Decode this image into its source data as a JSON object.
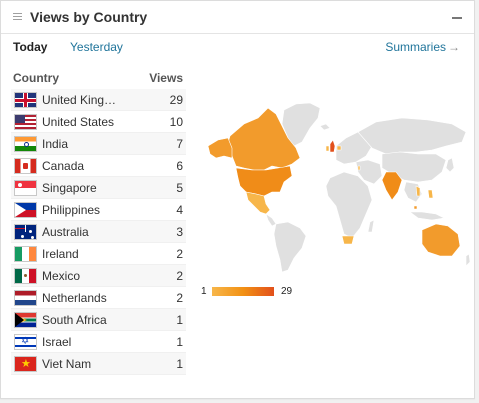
{
  "widget": {
    "title": "Views by Country",
    "tabs": {
      "today": "Today",
      "yesterday": "Yesterday"
    },
    "summaries_label": "Summaries",
    "summaries_arrow": "→",
    "columns": {
      "country": "Country",
      "views": "Views"
    }
  },
  "countries": [
    {
      "name": "United King…",
      "views": "29",
      "flag": "uk-flag"
    },
    {
      "name": "United States",
      "views": "10",
      "flag": "us-flag"
    },
    {
      "name": "India",
      "views": "7",
      "flag": "india-flag"
    },
    {
      "name": "Canada",
      "views": "6",
      "flag": "canada-flag"
    },
    {
      "name": "Singapore",
      "views": "5",
      "flag": "singapore-flag"
    },
    {
      "name": "Philippines",
      "views": "4",
      "flag": "philippines-flag"
    },
    {
      "name": "Australia",
      "views": "3",
      "flag": "australia-flag"
    },
    {
      "name": "Ireland",
      "views": "2",
      "flag": "ireland-flag"
    },
    {
      "name": "Mexico",
      "views": "2",
      "flag": "mexico-flag"
    },
    {
      "name": "Netherlands",
      "views": "2",
      "flag": "netherlands-flag"
    },
    {
      "name": "South Africa",
      "views": "1",
      "flag": "south-africa-flag"
    },
    {
      "name": "Israel",
      "views": "1",
      "flag": "israel-flag"
    },
    {
      "name": "Viet Nam",
      "views": "1",
      "flag": "vietnam-flag"
    }
  ],
  "legend": {
    "min": "1",
    "max": "29"
  },
  "colors": {
    "link": "#21759b",
    "map_land": "#e0e0e0",
    "map_water": "#ffffff",
    "scale_low": "#f7b64a",
    "scale_mid": "#f29114",
    "scale_high": "#e2501b"
  }
}
